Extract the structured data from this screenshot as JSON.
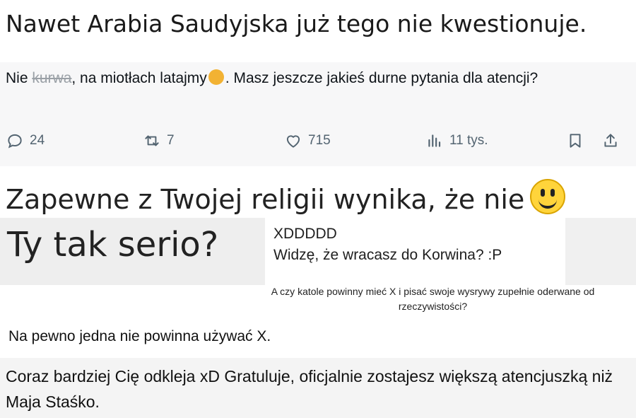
{
  "snippet1": {
    "text": "Nawet Arabia Saudyjska już tego nie kwestionuje."
  },
  "snippet2": {
    "before": "Nie ",
    "censored": "kurwa",
    "middle": ", na miotłach latajmy",
    "after": ". Masz jeszcze jakieś durne pytania dla atencji?",
    "actions": {
      "replies": "24",
      "reposts": "7",
      "likes": "715",
      "views": "11 tys."
    }
  },
  "snippet3": {
    "line1": "Zapewne z Twojej religii wynika, że nie",
    "line2": "Ty tak serio?",
    "reply1": "XDDDDD",
    "reply2": "Widzę, że wracasz do Korwina? :P"
  },
  "snippet4": {
    "text": "A czy katole powinny mieć X i pisać swoje wysrywy zupełnie oderwane od rzeczywistości?"
  },
  "snippet5": {
    "text": "Na pewno jedna nie powinna używać X."
  },
  "snippet6": {
    "text": "Coraz bardziej Cię odkleja xD Gratuluje, oficjalnie zostajesz większą atencjuszką niż Maja Staśko."
  },
  "colors": {
    "icon_gray": "#536471",
    "text": "#0f1419"
  }
}
